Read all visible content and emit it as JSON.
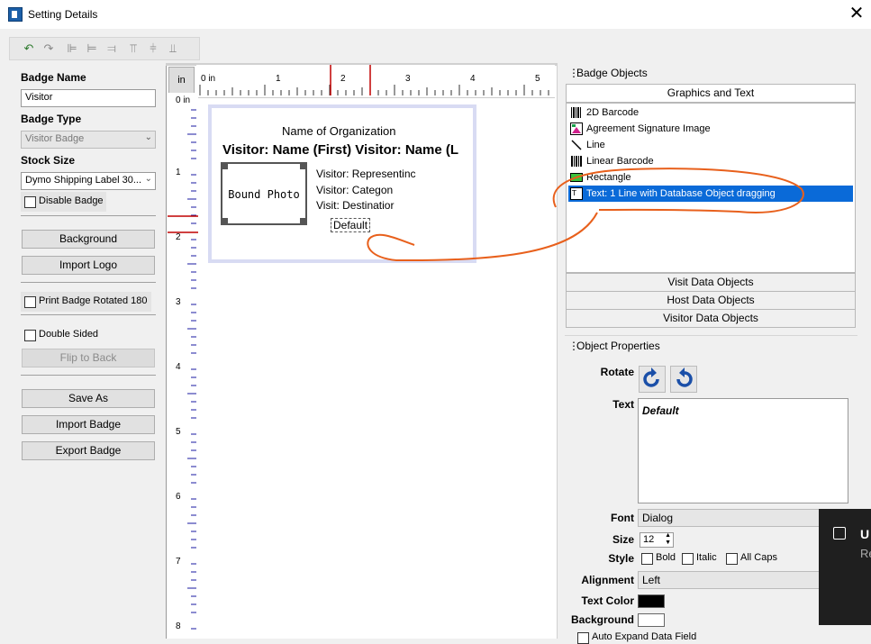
{
  "window": {
    "title": "Setting Details",
    "close_glyph": "✕"
  },
  "toolbar": {
    "icons": [
      "undo-icon",
      "redo-icon",
      "align-left-icon",
      "align-center-icon",
      "align-right-icon",
      "align-top-icon",
      "align-middle-icon",
      "align-bottom-icon"
    ]
  },
  "left": {
    "badge_name_label": "Badge Name",
    "badge_name_value": "Visitor",
    "badge_type_label": "Badge Type",
    "badge_type_value": "Visitor Badge",
    "stock_size_label": "Stock Size",
    "stock_size_value": "Dymo Shipping Label 30...",
    "disable_badge": "Disable Badge",
    "background_btn": "Background",
    "import_logo_btn": "Import Logo",
    "print_rotated": "Print Badge Rotated 180",
    "double_sided": "Double Sided",
    "flip_to_back": "Flip to Back",
    "save_as": "Save As",
    "import_badge": "Import Badge",
    "export_badge": "Export Badge"
  },
  "canvas": {
    "unit_btn": "in",
    "ruler_h": [
      "0 in",
      "1",
      "2",
      "3",
      "4",
      "5"
    ],
    "ruler_v": [
      "0 in",
      "1",
      "2",
      "3",
      "4",
      "5",
      "6",
      "7",
      "8"
    ],
    "badge": {
      "org": "Name of Organization",
      "visitor_name": "Visitor: Name (First) Visitor: Name (L",
      "photo": "Bound Photo",
      "line1": "Visitor: Representinc",
      "line2": "Visitor: Categon",
      "line3": "Visit: Destinatior",
      "default_text": "Default"
    }
  },
  "badge_objects": {
    "header": "Badge Objects",
    "tab_graphics": "Graphics and Text",
    "items": [
      {
        "label": "2D Barcode",
        "icon": "2d-barcode-icon"
      },
      {
        "label": "Agreement Signature Image",
        "icon": "image-icon"
      },
      {
        "label": "Line",
        "icon": "line-icon"
      },
      {
        "label": "Linear Barcode",
        "icon": "barcode-icon"
      },
      {
        "label": "Rectangle",
        "icon": "rectangle-icon"
      },
      {
        "label": "Text: 1 Line with Database Object dragging",
        "icon": "text-icon"
      }
    ],
    "tab_visit": "Visit Data Objects",
    "tab_host": "Host Data Objects",
    "tab_visitor": "Visitor Data Objects"
  },
  "object_properties": {
    "header": "Object Properties",
    "rotate_label": "Rotate",
    "text_label": "Text",
    "text_value": "Default",
    "font_label": "Font",
    "font_value": "Dialog",
    "size_label": "Size",
    "size_value": "12",
    "style_label": "Style",
    "bold": "Bold",
    "italic": "Italic",
    "all_caps": "All Caps",
    "alignment_label": "Alignment",
    "alignment_value": "Left",
    "text_color_label": "Text Color",
    "background_label": "Background",
    "auto_expand": "Auto Expand Data Field"
  },
  "toast": {
    "title": "U",
    "sub": "Re"
  },
  "colors": {
    "selection": "#0a6ad8",
    "annotation": "#e8601c",
    "ruler_guide": "#c00000"
  }
}
